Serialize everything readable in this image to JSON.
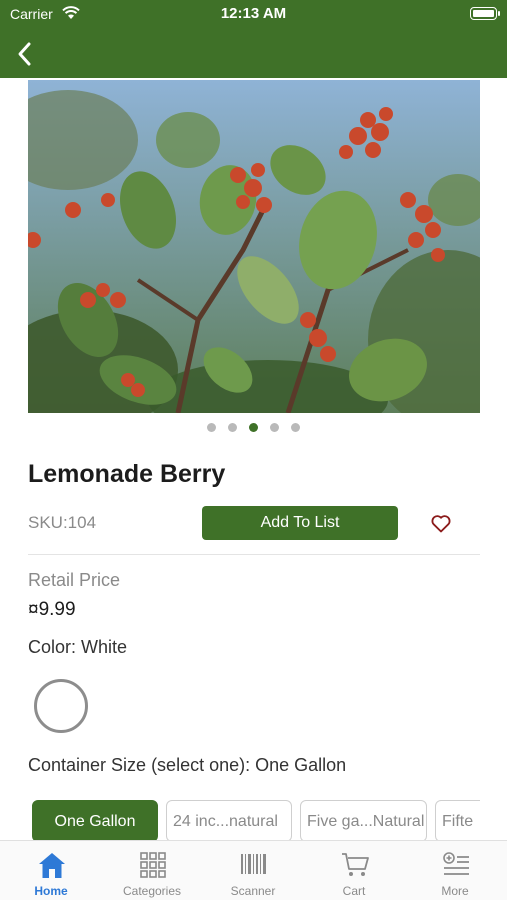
{
  "status_bar": {
    "carrier": "Carrier",
    "time": "12:13 AM"
  },
  "product": {
    "name": "Lemonade Berry",
    "sku": "SKU:104",
    "add_to_list_label": "Add To List",
    "retail_price_label": "Retail Price",
    "price": "¤9.99",
    "color_label": "Color: White",
    "container_label": "Container Size (select one): One Gallon",
    "carousel": {
      "count": 5,
      "active_index": 3
    }
  },
  "size_options": [
    {
      "label": "One Gallon",
      "selected": true
    },
    {
      "label": "24 inc...natural",
      "selected": false
    },
    {
      "label": "Five ga...Natural",
      "selected": false
    },
    {
      "label": "Fifte",
      "selected": false
    }
  ],
  "tabs": [
    {
      "label": "Home",
      "icon": "home-icon",
      "active": true
    },
    {
      "label": "Categories",
      "icon": "grid-icon",
      "active": false
    },
    {
      "label": "Scanner",
      "icon": "barcode-icon",
      "active": false
    },
    {
      "label": "Cart",
      "icon": "cart-icon",
      "active": false
    },
    {
      "label": "More",
      "icon": "more-list-icon",
      "active": false
    }
  ],
  "colors": {
    "brand": "#3f7128",
    "tab_active": "#2e79d6",
    "heart": "#8b1a1a"
  }
}
